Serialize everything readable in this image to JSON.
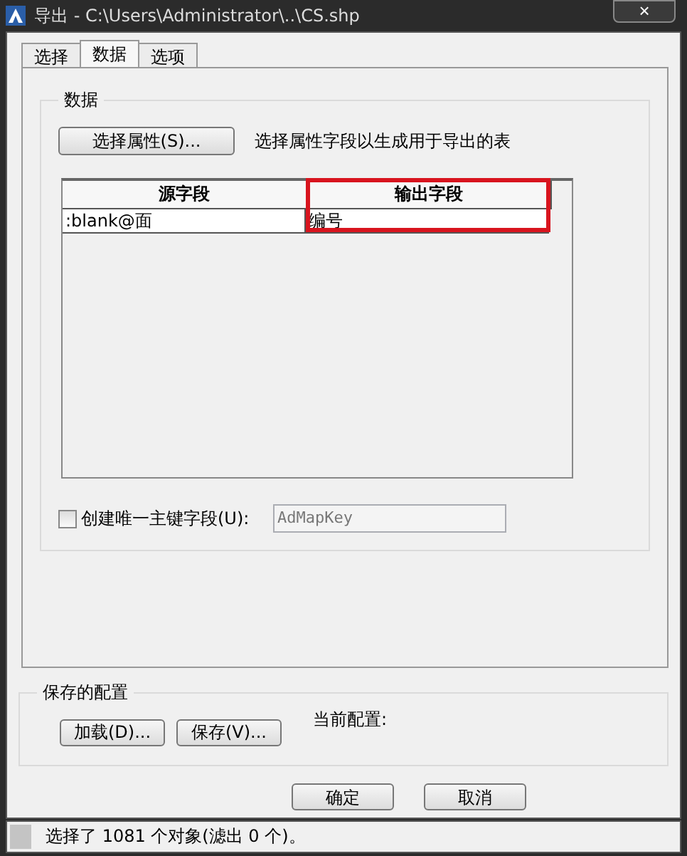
{
  "window": {
    "title": "导出 - C:\\Users\\Administrator\\..\\CS.shp",
    "close": "×"
  },
  "tabs": [
    {
      "label": "选择",
      "selected": false
    },
    {
      "label": "数据",
      "selected": true
    },
    {
      "label": "选项",
      "selected": false
    }
  ],
  "data_group": {
    "title": "数据",
    "select_button": "选择属性(S)...",
    "description": "选择属性字段以生成用于导出的表",
    "table": {
      "columns": [
        {
          "label": "源字段",
          "highlighted": false
        },
        {
          "label": "输出字段",
          "highlighted": true
        }
      ],
      "rows": [
        [
          ":blank@面",
          "编号"
        ]
      ]
    },
    "unique_key": {
      "label": "创建唯一主键字段(U):",
      "checked": false,
      "value": "AdMapKey",
      "disabled": true
    }
  },
  "config_group": {
    "title": "保存的配置",
    "load_button": "加载(D)...",
    "save_button": "保存(V)...",
    "current_label": "当前配置:"
  },
  "buttons": [
    "确定",
    "取消"
  ],
  "status_bar": "选择了 1081 个对象(滤出 0 个)。"
}
